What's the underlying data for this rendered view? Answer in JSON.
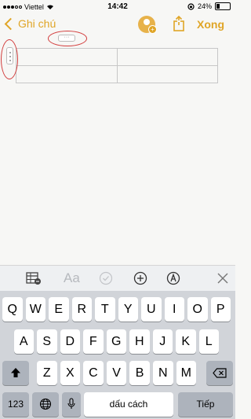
{
  "status": {
    "carrier": "Viettel",
    "time": "14:42",
    "battery": "24%",
    "battery_level": 0.24
  },
  "nav": {
    "back_label": "Ghi chú",
    "done_label": "Xong"
  },
  "keyboard": {
    "row1": [
      "Q",
      "W",
      "E",
      "R",
      "T",
      "Y",
      "U",
      "I",
      "O",
      "P"
    ],
    "row2": [
      "A",
      "S",
      "D",
      "F",
      "G",
      "H",
      "J",
      "K",
      "L"
    ],
    "row3": [
      "Z",
      "X",
      "C",
      "V",
      "B",
      "N",
      "M"
    ],
    "numbers_label": "123",
    "space_label": "dấu cách",
    "return_label": "Tiếp"
  },
  "toolbar": {
    "format_label": "Aa"
  },
  "colors": {
    "accent": "#e0a526",
    "annotation": "#d23b3b"
  }
}
